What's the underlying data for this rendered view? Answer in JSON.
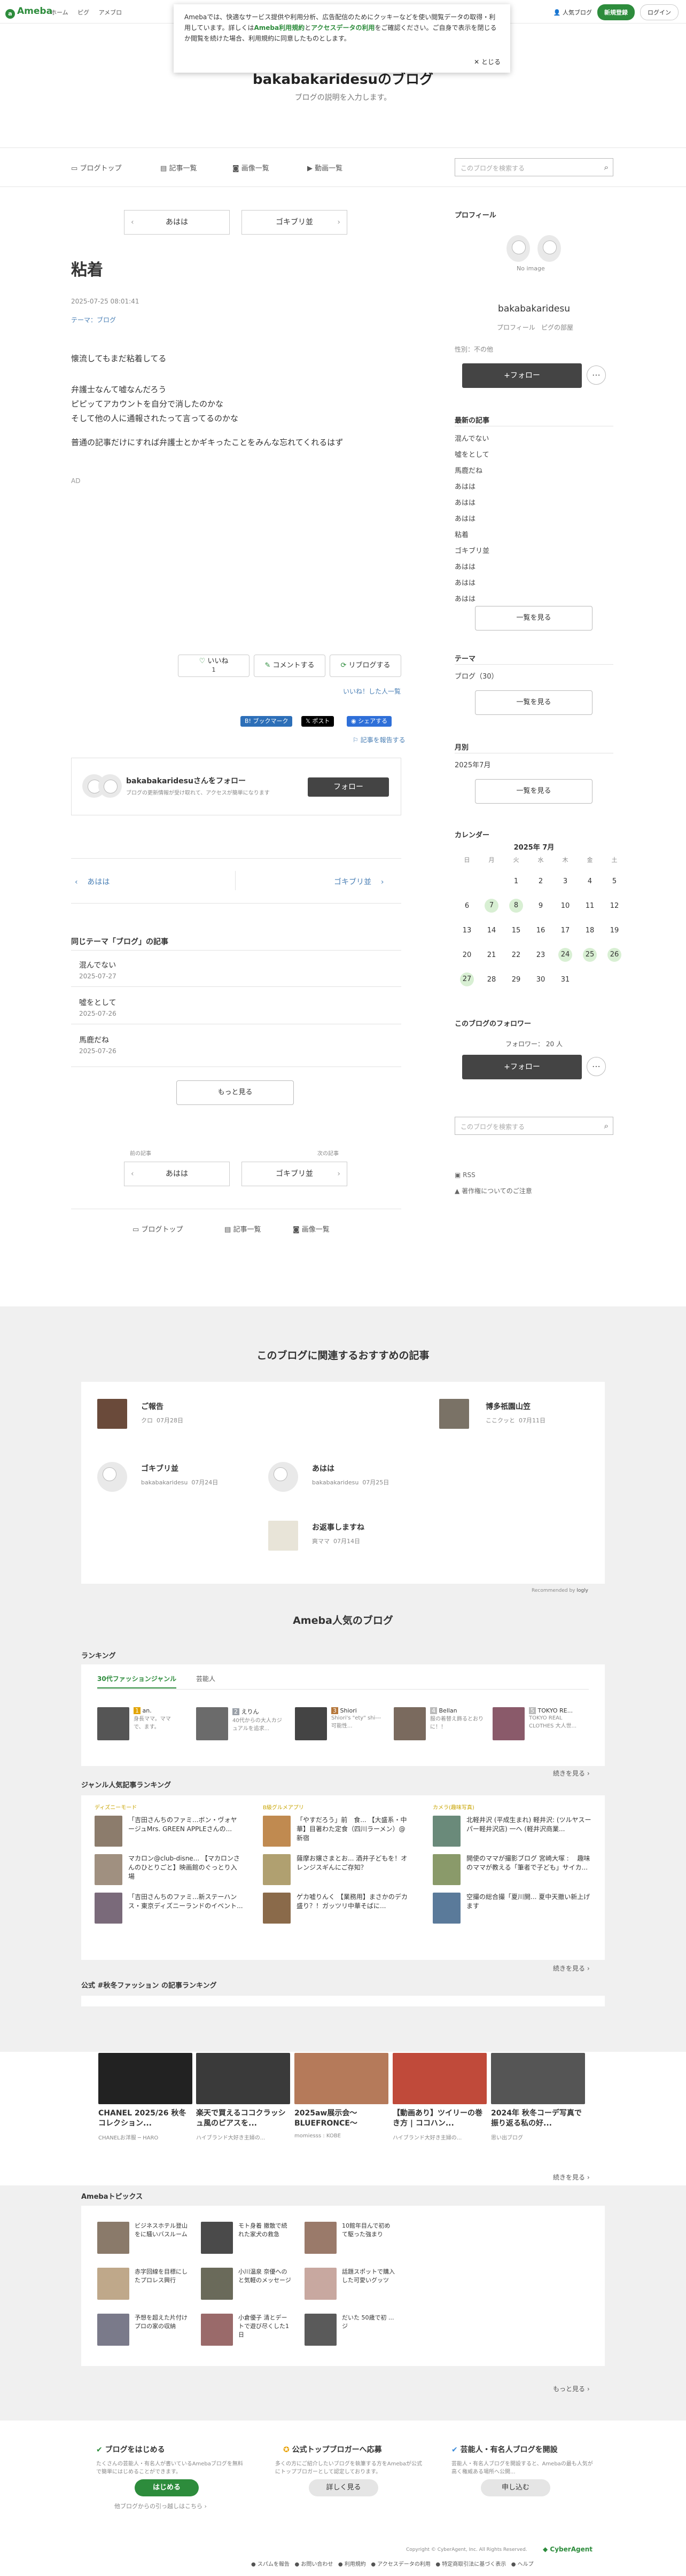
{
  "header": {
    "logo": "Ameba",
    "nav": [
      "ホーム",
      "ピグ",
      "アメブロ"
    ],
    "blog_link": "人気ブログ",
    "signup": "新規登録",
    "login": "ログイン"
  },
  "cookie": {
    "text": "Amebaでは、快適なサービス提供や利用分析、広告配信のためにクッキーなどを使い閲覧データの取得・利用しています。詳しくは",
    "link1": "Ameba利用規約",
    "mid": "と",
    "link2": "アクセスデータの利用",
    "tail": "をご確認ください。ご自身で表示を閉じるか閲覧を続けた場合、利用規約に同意したものとします。",
    "close": "とじる"
  },
  "blog": {
    "title": "bakabakaridesuのブログ",
    "desc": "ブログの説明を入力します。"
  },
  "subnav": {
    "top": "ブログトップ",
    "list": "記事一覧",
    "images": "画像一覧",
    "videos": "動画一覧",
    "search_placeholder": "このブログを検索する"
  },
  "pager": {
    "prev": "あはは",
    "next": "ゴキブリ並"
  },
  "article": {
    "title": "粘着",
    "date": "2025-07-25 08:01:41",
    "theme": "テーマ：ブログ",
    "lines": [
      "懐流してもまだ粘着してる",
      "弁護士なんて嘘なんだろう",
      "ピピッてアカウントを自分で消したのかな",
      "そして他の人に通報されたって言ってるのかな",
      "普通の記事だけにすれば弁護士とかギキったことをみんな忘れてくれるはず"
    ],
    "ad": "AD"
  },
  "reactions": {
    "like": "いいね",
    "like_count": "1",
    "comment": "コメントする",
    "reblog": "リブログする",
    "like_list": "いいね！した人一覧"
  },
  "share": {
    "hatena": "ブックマーク",
    "x": "ポスト",
    "line": "シェアする",
    "report": "記事を報告する"
  },
  "follow_card": {
    "name": "bakabakaridesuさんをフォロー",
    "desc": "ブログの更新情報が受け取れて、アクセスが簡単になります",
    "button": "フォロー"
  },
  "pager2": {
    "prev": "あはは",
    "next": "ゴキブリ並"
  },
  "same_theme": {
    "heading": "同じテーマ「ブログ」の記事",
    "items": [
      {
        "title": "混んでない",
        "date": "2025-07-27"
      },
      {
        "title": "噓をとして",
        "date": "2025-07-26"
      },
      {
        "title": "馬鹿だね",
        "date": "2025-07-26"
      }
    ],
    "more": "もっと見る"
  },
  "pager3": {
    "prev_label": "前の記事",
    "next_label": "次の記事",
    "prev": "あはは",
    "next": "ゴキブリ並"
  },
  "bottom_nav": {
    "top": "ブログトップ",
    "list": "記事一覧",
    "images": "画像一覧"
  },
  "sidebar": {
    "profile_h": "プロフィール",
    "no_image": "No image",
    "name": "bakabakaridesu",
    "profile_link": "プロフィール",
    "pigg_link": "ピグの部屋",
    "gender": "性別：不の他",
    "follow": "+フォロー",
    "recent_h": "最新の記事",
    "recent": [
      "混んでない",
      "噓をとして",
      "馬鹿だね",
      "あはは",
      "あはは",
      "あはは",
      "粘着",
      "ゴキブリ並",
      "あはは",
      "あはは",
      "あはは"
    ],
    "recent_more": "一覧を見る",
    "theme_h": "テーマ",
    "theme_item": "ブログ（30）",
    "theme_more": "一覧を見る",
    "month_h": "月別",
    "month_item": "2025年7月",
    "month_more": "一覧を見る",
    "cal_h": "カレンダー",
    "cal_title": "2025年 7月",
    "cal_week": [
      "日",
      "月",
      "火",
      "水",
      "木",
      "金",
      "土"
    ],
    "cal_rows": [
      [
        "",
        "",
        "1",
        "2",
        "3",
        "4",
        "5"
      ],
      [
        "6",
        "7",
        "8",
        "9",
        "10",
        "11",
        "12"
      ],
      [
        "13",
        "14",
        "15",
        "16",
        "17",
        "18",
        "19"
      ],
      [
        "20",
        "21",
        "22",
        "23",
        "24",
        "25",
        "26"
      ],
      [
        "27",
        "28",
        "29",
        "30",
        "31",
        "",
        ""
      ]
    ],
    "followers_h": "このブログのフォロワー",
    "followers": "フォロワー： 20 人",
    "follow2": "+フォロー",
    "search_placeholder": "このブログを検索する",
    "rss": "RSS",
    "copyright_link": "著作権についてのご注意"
  },
  "recommend": {
    "heading": "このブログに関連するおすすめの記事",
    "items": [
      {
        "title": "ご報告",
        "author": "クロ",
        "date": "07月28日"
      },
      {
        "title": "博多祇園山笠",
        "author": "ここクッと",
        "date": "07月11日"
      },
      {
        "title": "ゴキブリ並",
        "author": "bakabakaridesu",
        "date": "07月24日"
      },
      {
        "title": "あはは",
        "author": "bakabakaridesu",
        "date": "07月25日"
      },
      {
        "title": "お返事しますね",
        "author": "爽ママ",
        "date": "07月14日"
      }
    ],
    "powered": "Recommended by"
  },
  "popular": {
    "heading": "Ameba人気のブログ",
    "ranking_h": "ランキング",
    "tab1": "30代ファッションジャンル",
    "tab2": "芸能人",
    "ranking": [
      {
        "rank": "1",
        "name": "an.",
        "desc": "身長ママ。ママで、ます。"
      },
      {
        "rank": "2",
        "name": "えりん",
        "desc": "40代からの大人カジュアルを追求..."
      },
      {
        "rank": "3",
        "name": "Shiori",
        "desc": "Shiori's \"ety\" shi--- 可能性..."
      },
      {
        "rank": "4",
        "name": "Bellan",
        "desc": "服の着替え飾るとおりに！！"
      },
      {
        "rank": "5",
        "name": "TOKYO RE...",
        "desc": "TOKYO REAL CLOTHES 大人世..."
      }
    ],
    "more": "続きを見る",
    "genre_h": "ジャンル人気記事ランキング",
    "genres": [
      {
        "name": "ディズニーモード",
        "items": [
          "「吉田さんちのファミ...ボン・ヴォヤージュMrs. GREEN APPLEさんの...",
          "マカロン@club-disne... 【マカロンさんのひとりごと】映画館のぐっとり入場",
          "「吉田さんちのファミ...新ステーハンス・東京ディズニーランドのイベント..."
        ]
      },
      {
        "name": "B級グルメアプリ",
        "items": [
          "「やすだろう」前　食... 【大盛系・中華】目著わた定食（四川ラーメン）@新宿",
          "薩摩お嬢さまとお... 酒井子どもを！オレンジスギんにご存知？",
          "ゲカ嘘りんく 【業務用】まさかのデカ盛り？！ガッツリ中華そばに..."
        ]
      },
      {
        "name": "カメラ(趣味写真)",
        "items": [
          "北軽井沢 (平成生まれ) 軽井沢: (ツルヤスーパー軽井沢店) 一へ (軽井沢商業...",
          "開使のママが撮影ブログ 宮崎大塚 : 　趣味のママが教える「筆者で子ども」サイカ...",
          "空撮の総合撮「夏川開... 夏中天撤い新上げます"
        ]
      }
    ]
  },
  "fashion": {
    "heading": "公式 #秋冬ファッション の記事ランキング",
    "items": [
      {
        "title": "CHANEL 2025/26 秋冬コレクション...",
        "src": "CHANELお洋服 ─ HARO"
      },
      {
        "title": "楽天で買えるココクラッシュ風のピアスを...",
        "src": "ハイブランド大好き主婦の..."
      },
      {
        "title": "2025aw展示会～BLUEFRONCE～",
        "src": "momiesss : KOBE"
      },
      {
        "title": "【動画あり】ツイリーの巻き方 | ココハン...",
        "src": "ハイブランド大好き主婦の..."
      },
      {
        "title": "2024年 秋冬コーデ写真で振り返る私の好...",
        "src": "思い出ブログ"
      }
    ],
    "more": "続きを見る"
  },
  "topics": {
    "heading": "Amebaトピックス",
    "items": [
      "ビジネスホテル登山をに騒いバスルーム",
      "モト身着 撤散で続れた家犬の救急",
      "10館年目んで初めて駆った強まり",
      "赤字回線を目標にしたプロレス興行",
      "小川温泉 奈優へのと気軽のメッセージ",
      "話題スポットで購入した可愛いグッツ",
      "予想を超えた片付けプロの家の収納",
      "小倉優子 清とデートで遊び尽くした1日",
      "だいた 50歳で初 ...ジ"
    ],
    "more": "もっと見る"
  },
  "footer": {
    "cols": [
      {
        "h": "ブログをはじめる",
        "t": "たくさんの芸能人・有名人が書いているAmebaブログを無料で簡単にはじめることができます。",
        "btn": "はじめる",
        "link": "他ブログからの引っ越しはこちら"
      },
      {
        "h": "公式トップブロガーへ応募",
        "t": "多くの方にご紹介したいブログを執筆する方をAmebaが公式にトップブロガーとして認定しております。",
        "btn": "詳しく見る"
      },
      {
        "h": "芸能人・有名人ブログを開設",
        "t": "芸能人・有名人ブログを開設すると、Amebaの最も人気が高く権威ある場所へ公開...",
        "btn": "申し込む"
      }
    ],
    "copyright": "Copyright © CyberAgent, Inc. All Rights Reserved.",
    "ca": "CyberAgent",
    "links": [
      "スパムを報告",
      "お問い合わせ",
      "利用規約",
      "アクセスデータの利用",
      "特定商取引法に基づく表示",
      "ヘルプ"
    ]
  }
}
